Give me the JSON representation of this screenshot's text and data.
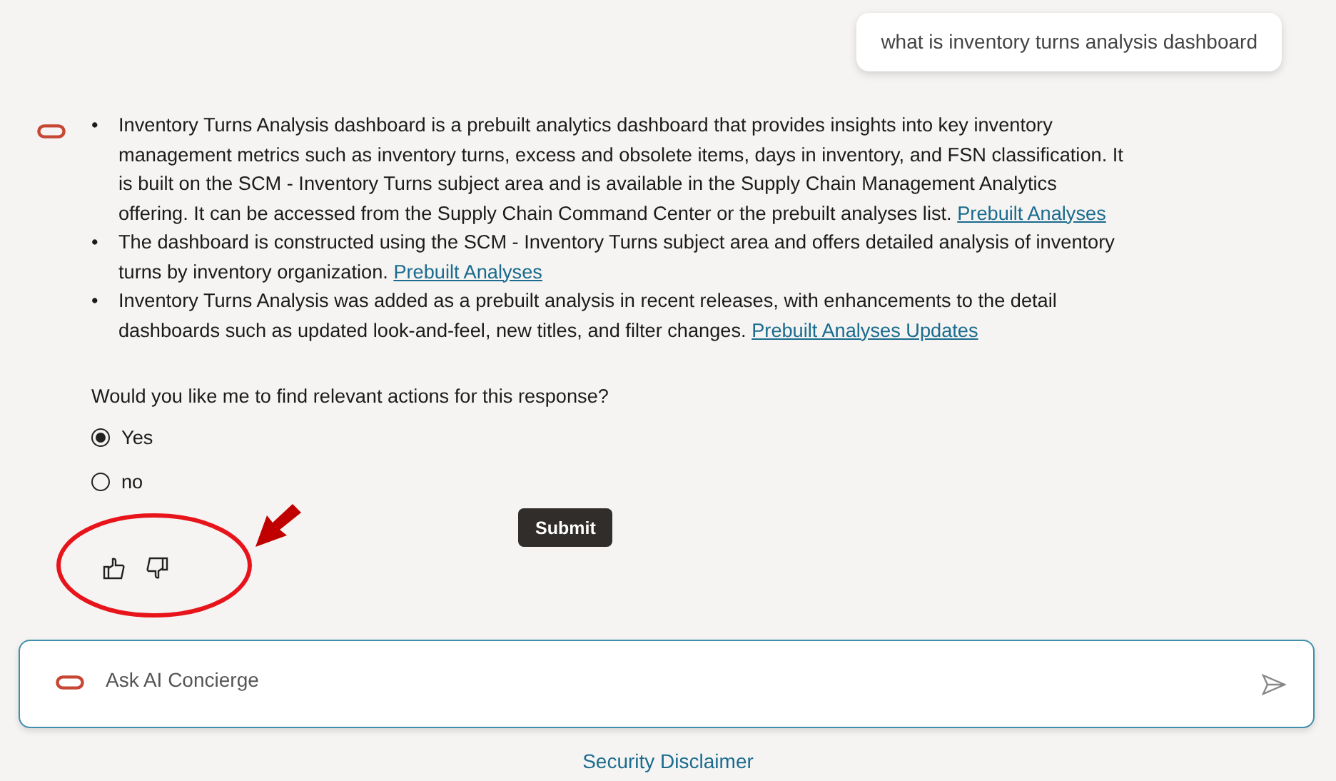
{
  "user_message": "what is inventory turns analysis dashboard",
  "answer": {
    "bullets": [
      {
        "marker": "•",
        "text": "Inventory Turns Analysis dashboard is a prebuilt analytics dashboard that provides insights into key inventory management metrics such as inventory turns, excess and obsolete items, days in inventory, and FSN classification. It is built on the SCM - Inventory Turns subject area and is available in the Supply Chain Management Analytics offering. It can be accessed from the Supply Chain Command Center or the prebuilt analyses list.",
        "link": "Prebuilt Analyses"
      },
      {
        "marker": "•",
        "text": "The dashboard is constructed using the SCM - Inventory Turns subject area and offers detailed analysis of inventory turns by inventory organization.",
        "link": "Prebuilt Analyses"
      },
      {
        "marker": "•",
        "text": "Inventory Turns Analysis was added as a prebuilt analysis in recent releases, with enhancements to the detail dashboards such as updated look-and-feel, new titles, and filter changes.",
        "link": "Prebuilt Analyses Updates"
      }
    ]
  },
  "question": "Would you like me to find relevant actions for this response?",
  "options": [
    {
      "label": "Yes",
      "selected": true
    },
    {
      "label": "no",
      "selected": false
    }
  ],
  "submit": "Submit",
  "input": {
    "placeholder": "Ask AI Concierge"
  },
  "footer_link": "Security Disclaimer"
}
